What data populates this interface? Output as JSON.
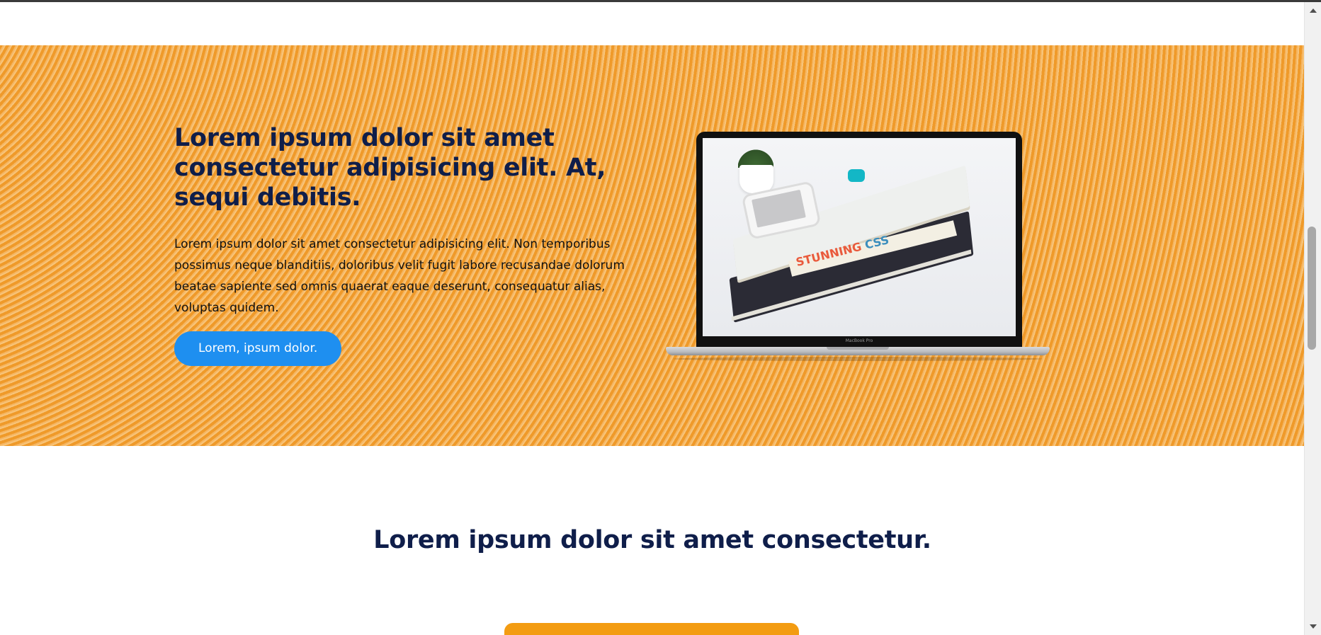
{
  "hero": {
    "title": "Lorem ipsum dolor sit amet consectetur adipisicing elit. At, sequi debitis.",
    "paragraph": "Lorem ipsum dolor sit amet consectetur adipisicing elit. Non temporibus possimus neque blanditiis, doloribus velit fugit labore recusandae dolorum beatae sapiente sed omnis quaerat eaque deserunt, consequatur alias, voluptas quidem.",
    "button_label": "Lorem, ipsum dolor.",
    "background_color": "#f2a43a",
    "image": {
      "laptop_brand": "MacBook Pro",
      "book_title": "STUNNING",
      "book_title_accent": "CSS"
    }
  },
  "section": {
    "title": "Lorem ipsum dolor sit amet consectetur."
  },
  "colors": {
    "heading": "#0f1e4a",
    "button": "#1e8ff0",
    "card": "#f39c12"
  },
  "scrollbar": {
    "up_icon": "chevron-up-icon",
    "down_icon": "chevron-down-icon"
  }
}
